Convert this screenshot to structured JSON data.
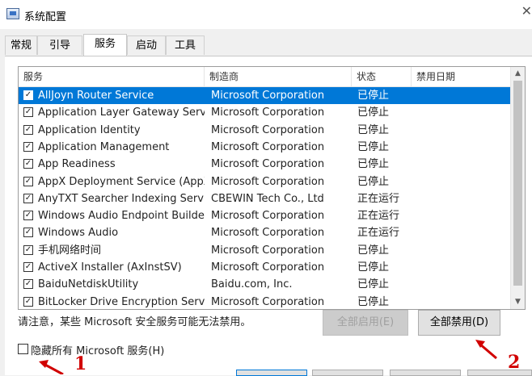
{
  "window": {
    "title": "系统配置"
  },
  "tabs": [
    "常规",
    "引导",
    "服务",
    "启动",
    "工具"
  ],
  "columns": [
    "服务",
    "制造商",
    "状态",
    "禁用日期"
  ],
  "services": [
    {
      "name": "AllJoyn Router Service",
      "maker": "Microsoft Corporation",
      "status": "已停止",
      "date": ""
    },
    {
      "name": "Application Layer Gateway Service",
      "maker": "Microsoft Corporation",
      "status": "已停止",
      "date": ""
    },
    {
      "name": "Application Identity",
      "maker": "Microsoft Corporation",
      "status": "已停止",
      "date": ""
    },
    {
      "name": "Application Management",
      "maker": "Microsoft Corporation",
      "status": "已停止",
      "date": ""
    },
    {
      "name": "App Readiness",
      "maker": "Microsoft Corporation",
      "status": "已停止",
      "date": ""
    },
    {
      "name": "AppX Deployment Service (AppX...",
      "maker": "Microsoft Corporation",
      "status": "已停止",
      "date": ""
    },
    {
      "name": "AnyTXT Searcher Indexing Service",
      "maker": "CBEWIN Tech Co., Ltd",
      "status": "正在运行",
      "date": ""
    },
    {
      "name": "Windows Audio Endpoint Builder",
      "maker": "Microsoft Corporation",
      "status": "正在运行",
      "date": ""
    },
    {
      "name": "Windows Audio",
      "maker": "Microsoft Corporation",
      "status": "正在运行",
      "date": ""
    },
    {
      "name": "手机网络时间",
      "maker": "Microsoft Corporation",
      "status": "已停止",
      "date": ""
    },
    {
      "name": "ActiveX Installer (AxInstSV)",
      "maker": "Microsoft Corporation",
      "status": "已停止",
      "date": ""
    },
    {
      "name": "BaiduNetdiskUtility",
      "maker": "Baidu.com, Inc.",
      "status": "已停止",
      "date": ""
    },
    {
      "name": "BitLocker Drive Encryption Service",
      "maker": "Microsoft Corporation",
      "status": "已停止",
      "date": ""
    }
  ],
  "selected_index": 0,
  "note": "请注意，某些 Microsoft 安全服务可能无法禁用。",
  "buttons": {
    "enable_all": "全部启用(E)",
    "disable_all": "全部禁用(D)"
  },
  "hide_ms": {
    "label": "隐藏所有 Microsoft 服务(H)",
    "checked": false
  },
  "annotations": [
    "1",
    "2"
  ],
  "colors": {
    "selection": "#0078d7",
    "annotation": "#d10000"
  }
}
